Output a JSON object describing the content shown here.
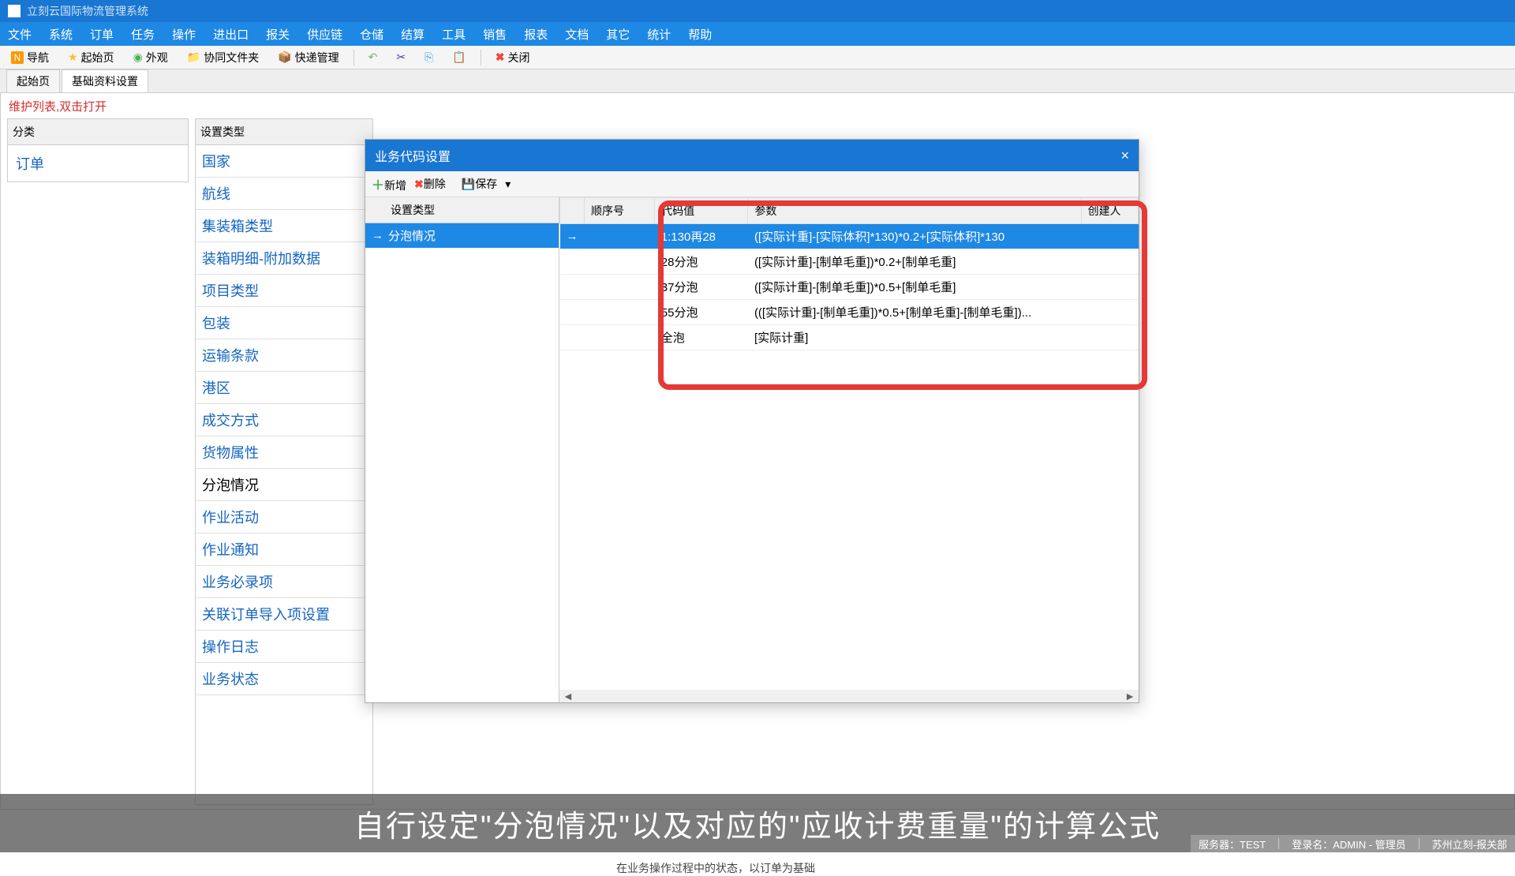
{
  "window": {
    "title": "立刻云国际物流管理系统"
  },
  "menu": [
    "文件",
    "系统",
    "订单",
    "任务",
    "操作",
    "进出口",
    "报关",
    "供应链",
    "仓储",
    "结算",
    "工具",
    "销售",
    "报表",
    "文档",
    "其它",
    "统计",
    "帮助"
  ],
  "toolbar": {
    "nav": "导航",
    "home": "起始页",
    "look": "外观",
    "collab": "协同文件夹",
    "express": "快递管理",
    "close": "关闭"
  },
  "tabs": {
    "home": "起始页",
    "settings": "基础资料设置"
  },
  "hint": "维护列表,双击打开",
  "leftHeader": "分类",
  "leftCategory": "订单",
  "midHeader": "设置类型",
  "midItems": [
    "国家",
    "航线",
    "集装箱类型",
    "装箱明细-附加数据",
    "项目类型",
    "包装",
    "运输条款",
    "港区",
    "成交方式",
    "货物属性",
    "分泡情况",
    "作业活动",
    "作业通知",
    "业务必录项",
    "关联订单导入项设置",
    "操作日志",
    "业务状态"
  ],
  "midSelected": 10,
  "desc": "在业务操作过程中的状态，以订单为基础",
  "dialog": {
    "title": "业务代码设置",
    "add": "新增",
    "del": "删除",
    "save": "保存",
    "leftTh": "设置类型",
    "leftRow": "分泡情况",
    "th": {
      "seq": "顺序号",
      "code": "代码值",
      "param": "参数",
      "creator": "创建人"
    },
    "rows": [
      {
        "code": "1:130再28",
        "param": "([实际计重]-[实际体积]*130)*0.2+[实际体积]*130"
      },
      {
        "code": "28分泡",
        "param": "([实际计重]-[制单毛重])*0.2+[制单毛重]"
      },
      {
        "code": "37分泡",
        "param": "([实际计重]-[制单毛重])*0.5+[制单毛重]"
      },
      {
        "code": "55分泡",
        "param": "(([实际计重]-[制单毛重])*0.5+[制单毛重]-[制单毛重])..."
      },
      {
        "code": "全泡",
        "param": "[实际计重]"
      }
    ]
  },
  "caption": "自行设定\"分泡情况\"以及对应的\"应收计费重量\"的计算公式",
  "status": {
    "server": "服务器：TEST",
    "login": "登录名：ADMIN - 管理员",
    "branch": "苏州立刻-报关部"
  }
}
